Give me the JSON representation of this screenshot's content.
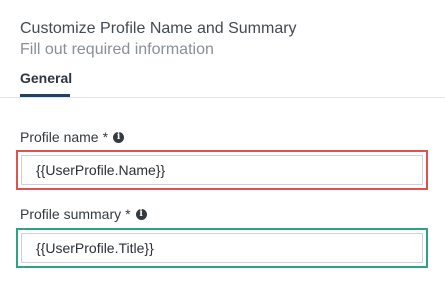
{
  "header": {
    "title": "Customize Profile Name and Summary",
    "subtitle": "Fill out required information"
  },
  "tabs": [
    {
      "label": "General",
      "active": true
    }
  ],
  "fields": [
    {
      "label": "Profile name",
      "required_mark": "*",
      "value": "{{UserProfile.Name}}",
      "highlight_color": "#e0524f"
    },
    {
      "label": "Profile summary",
      "required_mark": "*",
      "value": "{{UserProfile.Title}}",
      "highlight_color": "#2da386"
    }
  ],
  "icons": {
    "info": "info-icon"
  }
}
